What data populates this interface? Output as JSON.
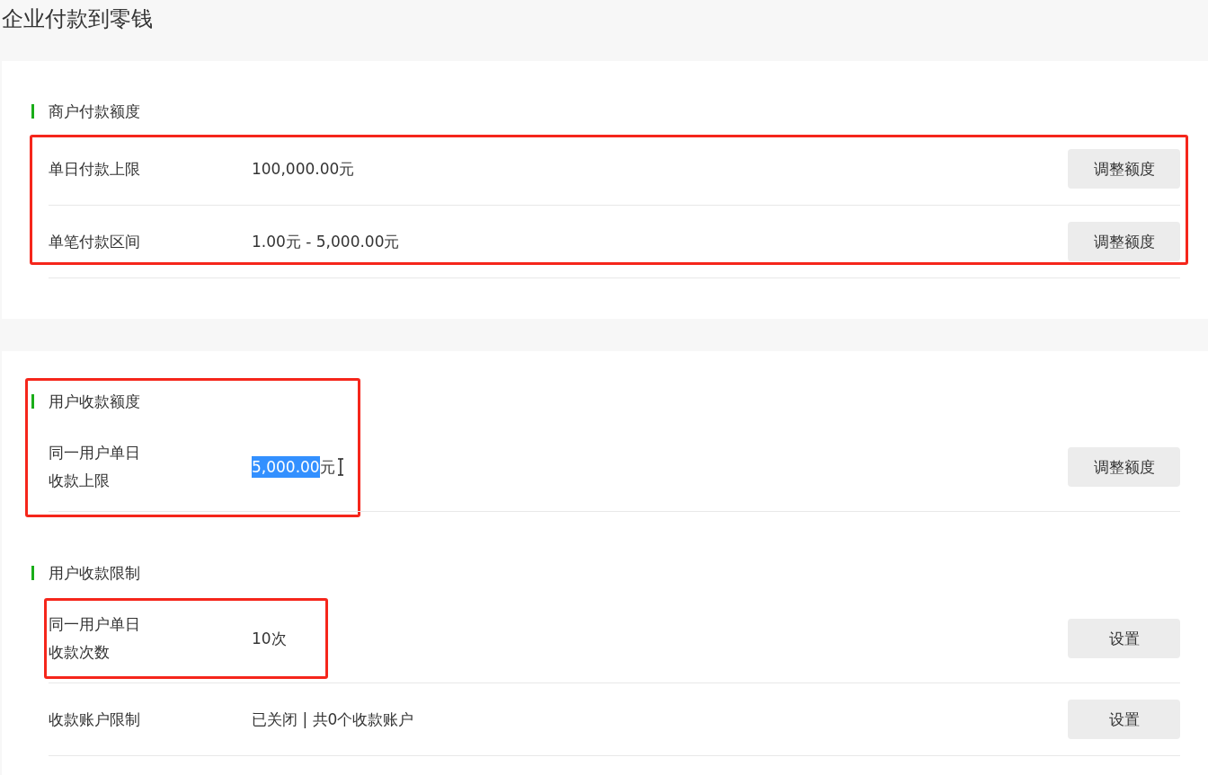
{
  "page_title": "企业付款到零钱",
  "sections": [
    {
      "heading": "商户付款额度",
      "framed": false,
      "rows_framed": true,
      "rows": [
        {
          "label": "单日付款上限",
          "value_parts": [
            {
              "text": "100,000.00元",
              "selected": false
            }
          ],
          "text_cursor": false,
          "framed": false,
          "button": "调整额度"
        },
        {
          "label": "单笔付款区间",
          "value_parts": [
            {
              "text": "1.00元 - 5,000.00元",
              "selected": false
            }
          ],
          "text_cursor": false,
          "framed": false,
          "button": "调整额度"
        }
      ]
    },
    {
      "heading": "用户收款额度",
      "framed": true,
      "rows_framed": false,
      "rows": [
        {
          "label": "同一用户单日收款上限",
          "value_parts": [
            {
              "text": "5,000.00",
              "selected": true
            },
            {
              "text": "元",
              "selected": false
            }
          ],
          "text_cursor": true,
          "framed": false,
          "button": "调整额度"
        }
      ]
    },
    {
      "heading": "用户收款限制",
      "framed": false,
      "rows_framed": false,
      "rows": [
        {
          "label": "同一用户单日收款次数",
          "value_parts": [
            {
              "text": "10次",
              "selected": false
            }
          ],
          "text_cursor": false,
          "framed": true,
          "button": "设置"
        },
        {
          "label": "收款账户限制",
          "value_parts": [
            {
              "text": "已关闭 | 共0个收款账户",
              "selected": false
            }
          ],
          "text_cursor": false,
          "framed": false,
          "button": "设置"
        }
      ]
    }
  ]
}
